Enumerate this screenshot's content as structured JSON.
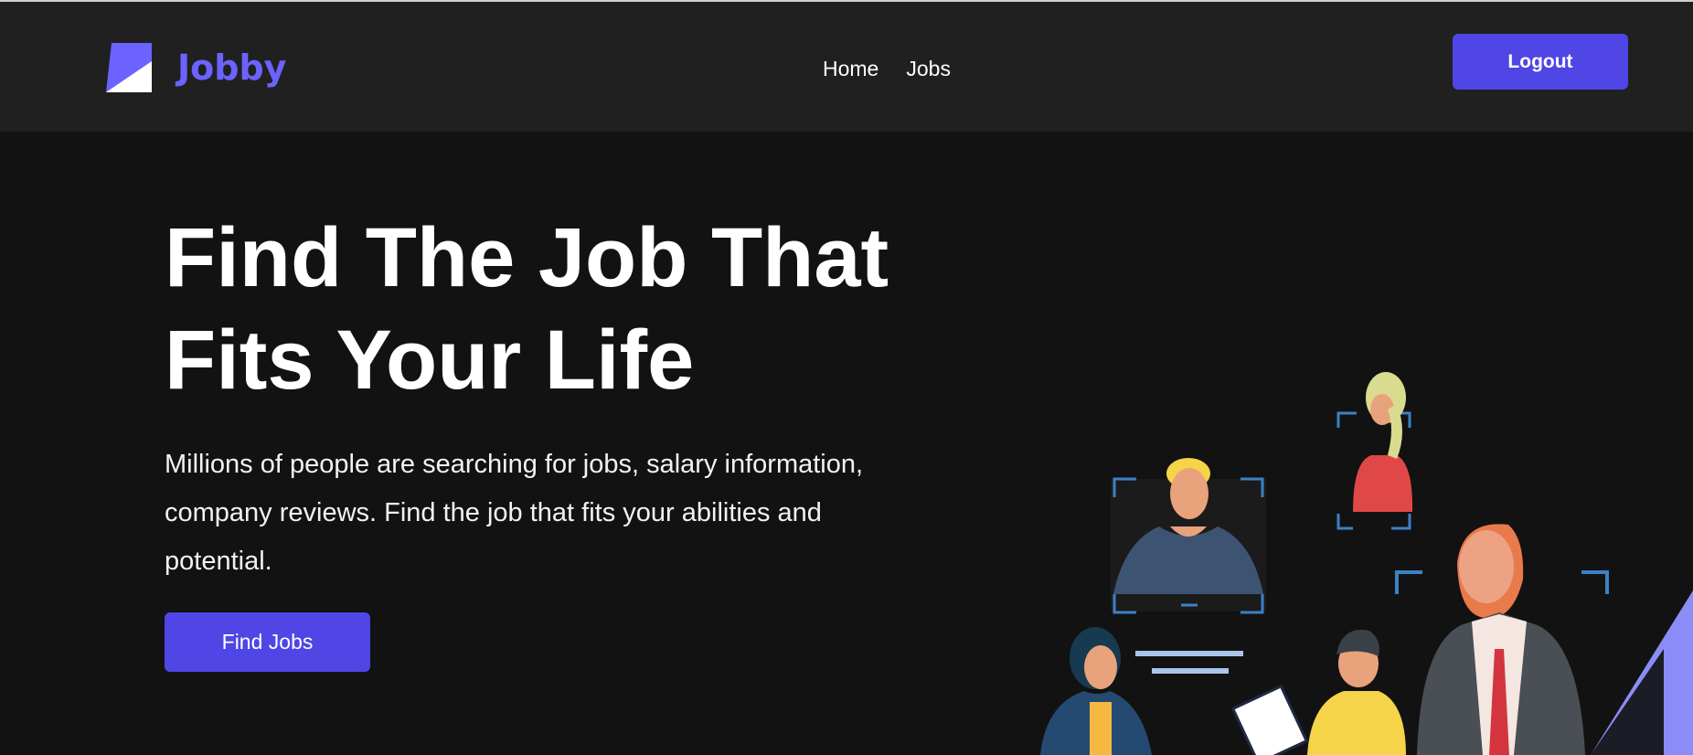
{
  "navbar": {
    "logo_text": "Jobby",
    "links": [
      {
        "label": "Home"
      },
      {
        "label": "Jobs"
      }
    ],
    "logout_label": "Logout"
  },
  "hero": {
    "title_line1": "Find The Job That",
    "title_line2": "Fits Your Life",
    "description": "Millions of people are searching for jobs, salary information, company reviews. Find the job that fits your abilities and potential.",
    "cta_label": "Find Jobs"
  },
  "colors": {
    "accent": "#4f46e5",
    "logo": "#6c63ff",
    "background": "#121212",
    "navbar": "#202020"
  },
  "icons": {
    "logo": "jobby-logo-icon"
  }
}
